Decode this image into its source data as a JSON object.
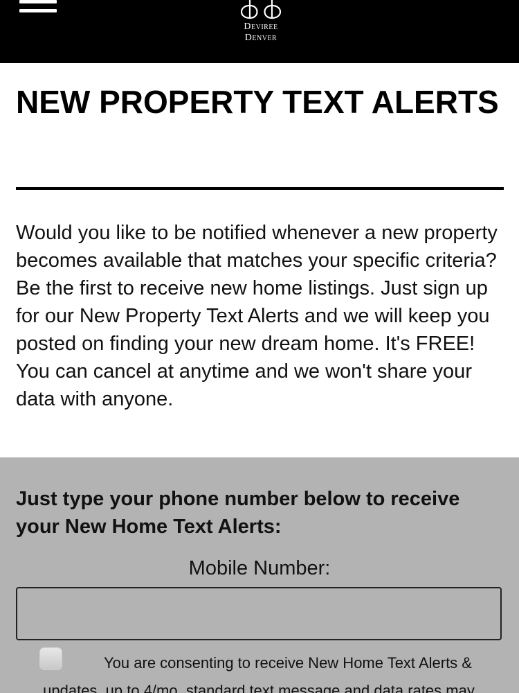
{
  "header": {
    "menu_icon": "hamburger-menu-icon",
    "logo_icon": "dd-monogram-icon",
    "logo_line1": "Deviree",
    "logo_line2": "Denver",
    "background": "#000000"
  },
  "main": {
    "title": "NEW PROPERTY TEXT ALERTS",
    "intro": "Would you like to be notified whenever a new property becomes available that matches your specific criteria? Be the first to receive new home listings. Just sign up for our New Property Text Alerts and we will keep you posted on finding your new dream home. It's FREE! You can cancel at anytime and we won't share your data with anyone."
  },
  "form": {
    "background": "#b3b3b3",
    "prompt": "Just type your phone number below to receive your New Home Text Alerts:",
    "mobile_label": "Mobile Number:",
    "mobile_value": "",
    "consent_text": "You are consenting to receive New Home Text Alerts & updates, up to 4/mo, standard text message and data rates may"
  }
}
